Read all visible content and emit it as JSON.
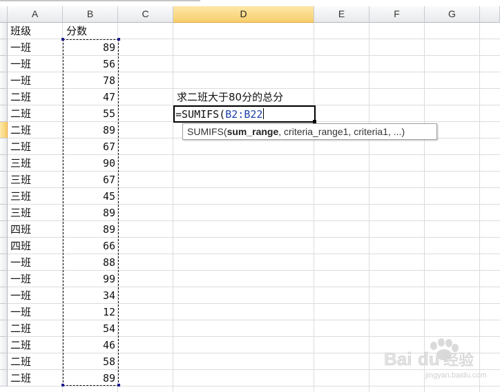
{
  "columns": [
    {
      "label": "A",
      "active": false
    },
    {
      "label": "B",
      "active": false
    },
    {
      "label": "C",
      "active": false
    },
    {
      "label": "D",
      "active": true
    },
    {
      "label": "E",
      "active": false
    },
    {
      "label": "F",
      "active": false
    },
    {
      "label": "G",
      "active": false
    }
  ],
  "active_row_index": 6,
  "header_row": {
    "a": "班级",
    "b": "分数"
  },
  "rows": [
    {
      "a": "一班",
      "b": "89"
    },
    {
      "a": "一班",
      "b": "56"
    },
    {
      "a": "一班",
      "b": "78"
    },
    {
      "a": "二班",
      "b": "47"
    },
    {
      "a": "二班",
      "b": "55"
    },
    {
      "a": "二班",
      "b": "89"
    },
    {
      "a": "二班",
      "b": "67"
    },
    {
      "a": "三班",
      "b": "90"
    },
    {
      "a": "三班",
      "b": "67"
    },
    {
      "a": "三班",
      "b": "45"
    },
    {
      "a": "三班",
      "b": "89"
    },
    {
      "a": "四班",
      "b": "89"
    },
    {
      "a": "四班",
      "b": "66"
    },
    {
      "a": "一班",
      "b": "88"
    },
    {
      "a": "一班",
      "b": "99"
    },
    {
      "a": "一班",
      "b": "34"
    },
    {
      "a": "一班",
      "b": "12"
    },
    {
      "a": "二班",
      "b": "54"
    },
    {
      "a": "二班",
      "b": "46"
    },
    {
      "a": "二班",
      "b": "58"
    },
    {
      "a": "二班",
      "b": "89"
    }
  ],
  "note_text": "求二班大于80分的总分",
  "formula": {
    "prefix": "=SUMIFS(",
    "reference": "B2:B22"
  },
  "tooltip": {
    "func": "SUMIFS(",
    "current_arg": "sum_range",
    "rest": ", criteria_range1, criteria1, ...)"
  },
  "watermark": {
    "logo": "Bai",
    "logo2": "du",
    "cn": "经验",
    "url": "jingyan.baidu.com"
  },
  "colors": {
    "active_header": "#f7cf6c",
    "reference": "#1c3fa8",
    "gridline": "#dadcdd"
  }
}
